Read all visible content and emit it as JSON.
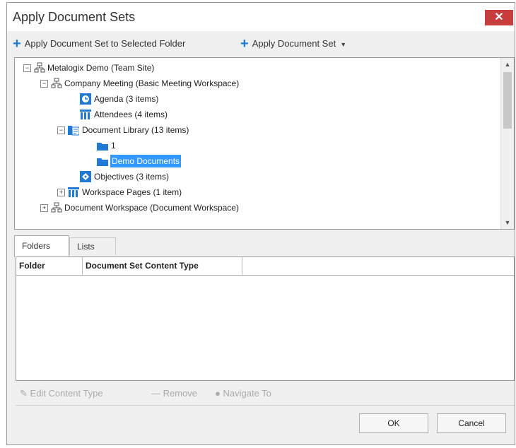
{
  "window": {
    "title": "Apply Document Sets",
    "close_label": "✕"
  },
  "toolbar": {
    "apply_selected_label": "Apply Document Set to Selected Folder",
    "apply_label": "Apply Document Set"
  },
  "tree": {
    "items": [
      {
        "label": "Metalogix Demo (Team Site)",
        "icon": "site-icon",
        "expander": "−"
      },
      {
        "label": "Company Meeting (Basic Meeting Workspace)",
        "icon": "site-icon",
        "expander": "−"
      },
      {
        "label": "Agenda (3 items)",
        "icon": "clock-list-icon",
        "expander": ""
      },
      {
        "label": "Attendees (4 items)",
        "icon": "list-icon",
        "expander": ""
      },
      {
        "label": "Document Library (13 items)",
        "icon": "library-icon",
        "expander": "−"
      },
      {
        "label": "1",
        "icon": "folder-icon",
        "expander": ""
      },
      {
        "label": "Demo Documents",
        "icon": "folder-icon",
        "expander": "",
        "selected": true
      },
      {
        "label": "Objectives (3 items)",
        "icon": "objectives-icon",
        "expander": ""
      },
      {
        "label": "Workspace Pages (1 item)",
        "icon": "list-icon",
        "expander": "+"
      },
      {
        "label": "Document Workspace (Document Workspace)",
        "icon": "site-icon",
        "expander": "+"
      }
    ]
  },
  "tabs": [
    {
      "label": "Folders",
      "active": true
    },
    {
      "label": "Lists",
      "active": false
    }
  ],
  "grid": {
    "columns": [
      "Folder",
      "Document Set Content Type"
    ]
  },
  "bottom_toolbar": {
    "edit_label": "Edit Content Type",
    "remove_label": "Remove",
    "navigate_label": "Navigate To"
  },
  "buttons": {
    "ok": "OK",
    "cancel": "Cancel"
  },
  "colors": {
    "accent": "#1e7ad4",
    "close": "#c73c3c",
    "selection": "#3399ff"
  }
}
